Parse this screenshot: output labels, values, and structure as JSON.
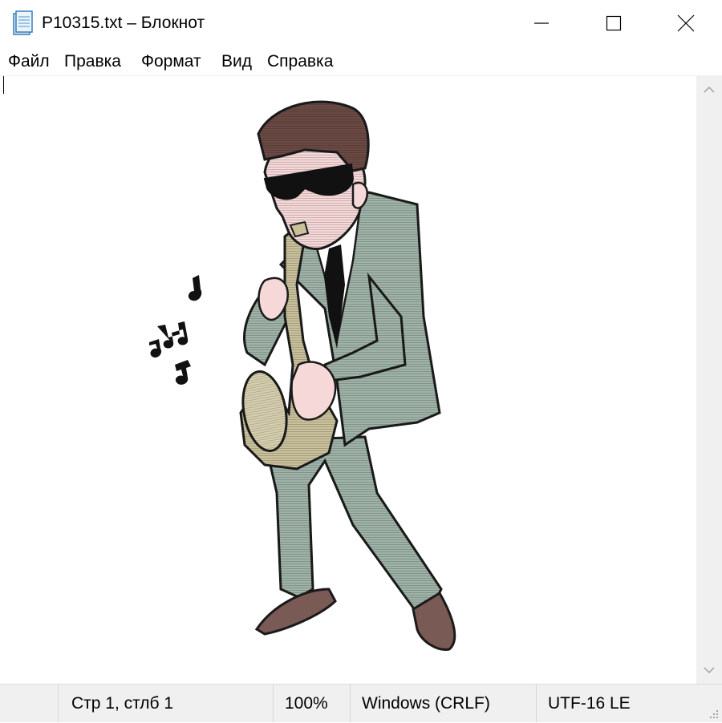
{
  "window": {
    "title": "P10315.txt – Блокнот",
    "controls": [
      "minimize",
      "maximize",
      "close"
    ]
  },
  "menu": {
    "items": [
      "Файл",
      "Правка",
      "Формат",
      "Вид",
      "Справка"
    ]
  },
  "editor": {
    "content_icon": "saxophone-player-ascii-art"
  },
  "status": {
    "position": "Стр 1, стлб 1",
    "zoom": "100%",
    "line_ending": "Windows (CRLF)",
    "encoding": "UTF-16 LE"
  },
  "colors": {
    "suit": "#9fb3a8",
    "skin": "#f6d8d8",
    "hair": "#6b4a44",
    "sax": "#c9c19c",
    "shoes": "#7a5a55"
  }
}
